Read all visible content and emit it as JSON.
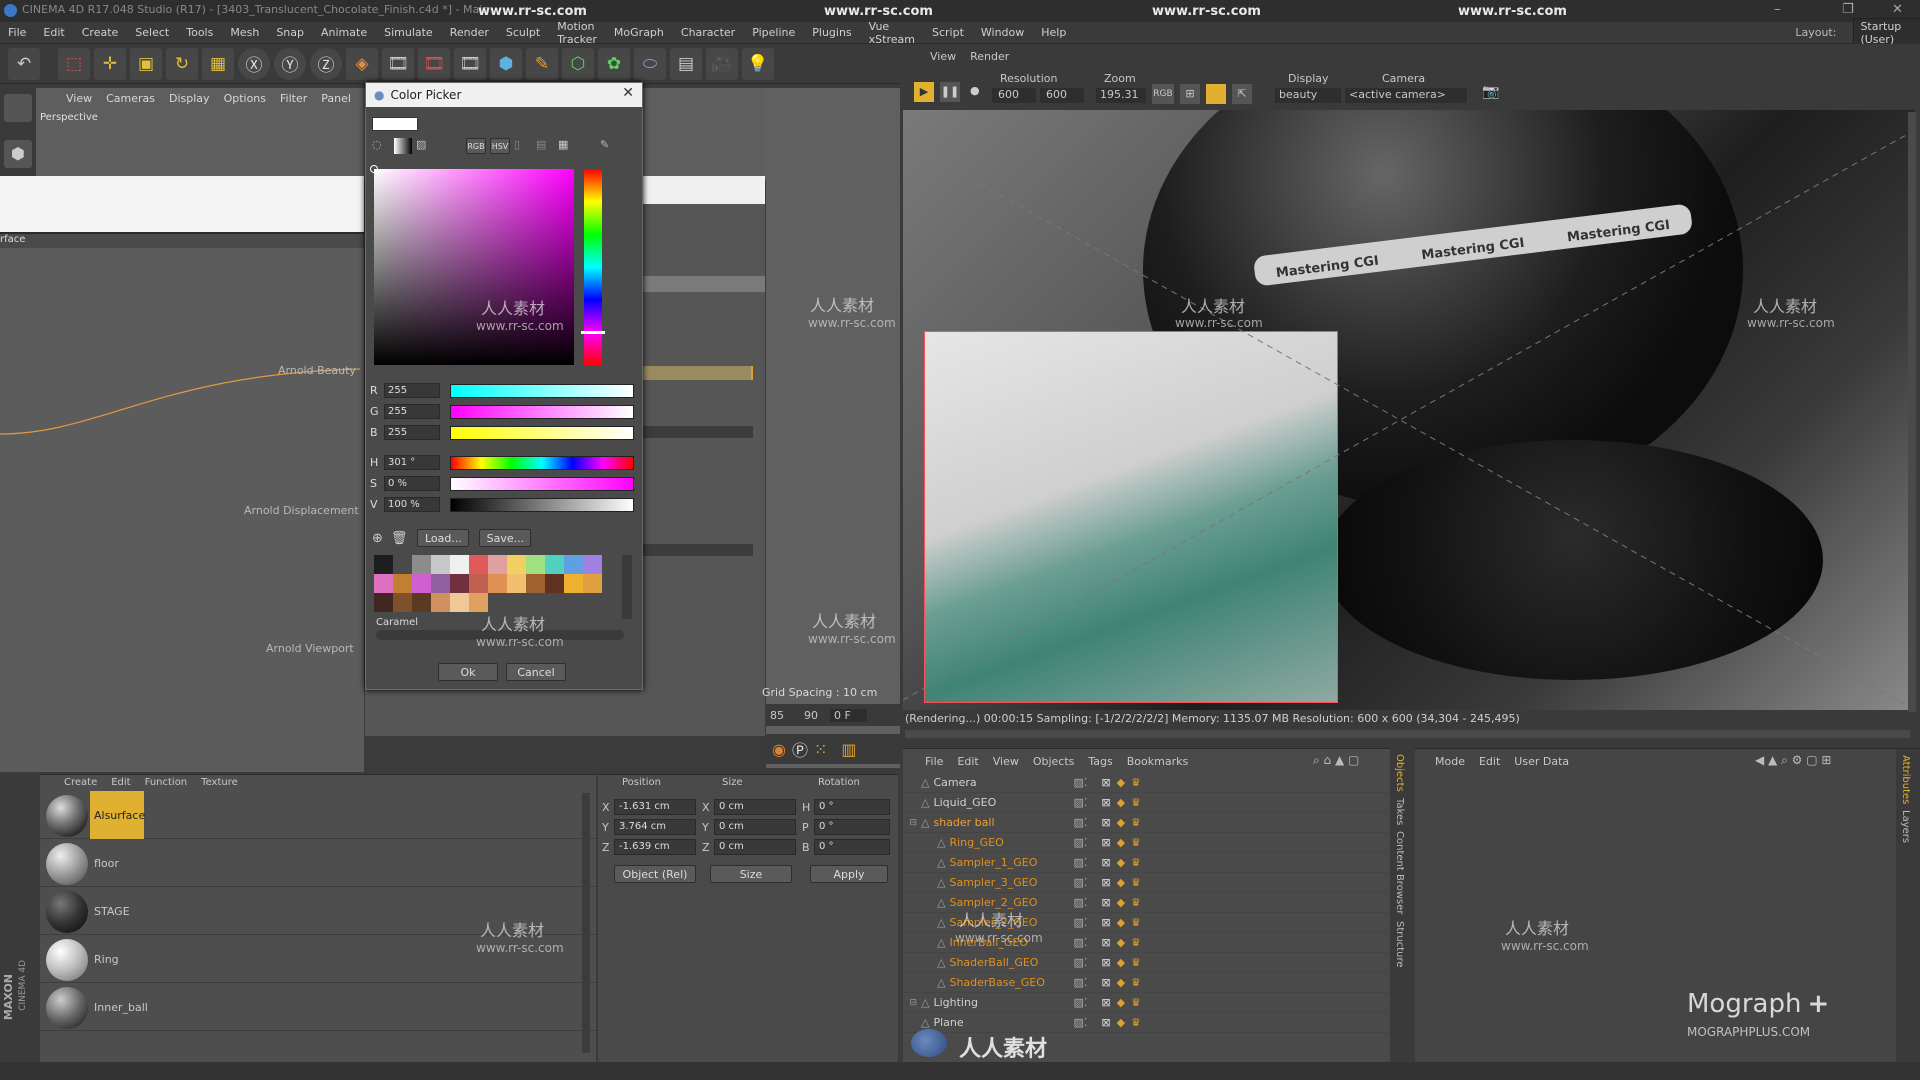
{
  "window": {
    "title": "CINEMA 4D R17.048 Studio (R17) - [3403_Translucent_Chocolate_Finish.c4d *] - Main",
    "watermark_urls": [
      "www.rr-sc.com",
      "www.rr-sc.com",
      "www.rr-sc.com",
      "www.rr-sc.com"
    ],
    "layout_label": "Layout:",
    "layout_value": "Startup (User)"
  },
  "menubar": [
    "File",
    "Edit",
    "Create",
    "Select",
    "Tools",
    "Mesh",
    "Snap",
    "Animate",
    "Simulate",
    "Render",
    "Sculpt",
    "Motion Tracker",
    "MoGraph",
    "Character",
    "Pipeline",
    "Plugins",
    "Vue xStream",
    "Script",
    "Window",
    "Help"
  ],
  "viewport": {
    "menu": [
      "View",
      "Cameras",
      "Display",
      "Options",
      "Filter",
      "Panel"
    ],
    "label": "Perspective",
    "grid_spacing": "Grid Spacing : 10 cm"
  },
  "node_editor": {
    "header": "rface",
    "ports": [
      "Arnold Beauty",
      "Arnold Displacement",
      "Arnold Viewport"
    ]
  },
  "color_picker": {
    "title": "Color Picker",
    "mode_buttons": [
      "RGB",
      "HSV"
    ],
    "rgb": [
      {
        "label": "R",
        "value": "255"
      },
      {
        "label": "G",
        "value": "255"
      },
      {
        "label": "B",
        "value": "255"
      }
    ],
    "hsv": [
      {
        "label": "H",
        "value": "301 °"
      },
      {
        "label": "S",
        "value": "0 %"
      },
      {
        "label": "V",
        "value": "100 %"
      }
    ],
    "load_label": "Load...",
    "save_label": "Save...",
    "swatch_group": "Caramel",
    "swatches": [
      "#1e1e1e",
      "#4a4a4a",
      "#8c8c8c",
      "#c8c8c8",
      "#f0f0f0",
      "#e05a5a",
      "#e0a0a0",
      "#f0d060",
      "#a0e080",
      "#50d0c0",
      "#60a0e0",
      "#a080e0",
      "#e070c0",
      "#c08030",
      "#d060d0",
      "#9060a0",
      "#703040",
      "#c06050",
      "#e09050",
      "#f0c070",
      "#a06030",
      "#603020",
      "#f0b030",
      "#e0a040",
      "#402820",
      "#80502a",
      "#5a3a20",
      "#d09060",
      "#f0c898",
      "#e0a060"
    ],
    "ok_label": "Ok",
    "cancel_label": "Cancel",
    "colors": {
      "current": "#ffffff"
    }
  },
  "render_view": {
    "menu": [
      "View",
      "Render"
    ],
    "resolution_label": "Resolution",
    "res_w": "600",
    "res_h": "600",
    "zoom_label": "Zoom",
    "zoom_value": "195.31",
    "display_label": "Display",
    "display_value": "beauty",
    "camera_label": "Camera",
    "camera_value": "<active camera>",
    "rgb_label": "RGB",
    "status": "(Rendering...) 00:00:15  Sampling: [-1/2/2/2/2/2]  Memory: 1135.07 MB  Resolution: 600 x 600 (34,304 - 245,495)",
    "ball_text": [
      "Mastering CGI",
      "Mastering CGI",
      "Mastering CGI"
    ]
  },
  "timeline": {
    "frame_a": "85",
    "frame_b": "90",
    "current_frame": "0 F"
  },
  "materials": {
    "menu": [
      "Create",
      "Edit",
      "Function",
      "Texture"
    ],
    "items": [
      {
        "name": "Alsurface",
        "selected": true
      },
      {
        "name": "floor",
        "selected": false
      },
      {
        "name": "STAGE",
        "selected": false
      },
      {
        "name": "Ring",
        "selected": false
      },
      {
        "name": "Inner_ball",
        "selected": false
      }
    ]
  },
  "coordinates": {
    "headers": [
      "Position",
      "Size",
      "Rotation"
    ],
    "rows": [
      {
        "axis": "X",
        "pos": "-1.631 cm",
        "size_axis": "X",
        "size": "0 cm",
        "rot_axis": "H",
        "rot": "0 °"
      },
      {
        "axis": "Y",
        "pos": "3.764 cm",
        "size_axis": "Y",
        "size": "0 cm",
        "rot_axis": "P",
        "rot": "0 °"
      },
      {
        "axis": "Z",
        "pos": "-1.639 cm",
        "size_axis": "Z",
        "size": "0 cm",
        "rot_axis": "B",
        "rot": "0 °"
      }
    ],
    "mode": "Object (Rel)",
    "size_mode": "Size",
    "apply_label": "Apply"
  },
  "objects": {
    "menu": [
      "File",
      "Edit",
      "View",
      "Objects",
      "Tags",
      "Bookmarks"
    ],
    "items": [
      {
        "name": "Camera",
        "level": 0,
        "color": "#d0d0d0"
      },
      {
        "name": "Liquid_GEO",
        "level": 0,
        "color": "#d0d0d0"
      },
      {
        "name": "shader ball",
        "level": 0,
        "color": "#f0a030"
      },
      {
        "name": "Ring_GEO",
        "level": 1,
        "color": "#e09020"
      },
      {
        "name": "Sampler_1_GEO",
        "level": 1,
        "color": "#e09020"
      },
      {
        "name": "Sampler_3_GEO",
        "level": 1,
        "color": "#e09020"
      },
      {
        "name": "Sampler_2_GEO",
        "level": 1,
        "color": "#e09020"
      },
      {
        "name": "Sampler_2_GEO",
        "level": 1,
        "color": "#e09020"
      },
      {
        "name": "InnerBall_GEO",
        "level": 1,
        "color": "#e09020"
      },
      {
        "name": "ShaderBall_GEO",
        "level": 1,
        "color": "#e09020"
      },
      {
        "name": "ShaderBase_GEO",
        "level": 1,
        "color": "#e09020"
      },
      {
        "name": "Lighting",
        "level": 0,
        "color": "#d0d0d0"
      },
      {
        "name": "Plane",
        "level": 0,
        "color": "#d0d0d0"
      }
    ]
  },
  "side_tabs": [
    "Objects",
    "Takes",
    "Content Browser",
    "Structure"
  ],
  "attributes": {
    "menu": [
      "Mode",
      "Edit",
      "User Data"
    ],
    "side_tabs": [
      "Attributes",
      "Layers"
    ]
  },
  "branding": {
    "maxon": "MAXON",
    "cinema": "CINEMA 4D",
    "mograph": "Mograph",
    "mograph_plus": "+",
    "mograph_url": "MOGRAPHPLUS.COM",
    "wm_cn": "人人素材",
    "wm_url": "www.rr-sc.com"
  }
}
